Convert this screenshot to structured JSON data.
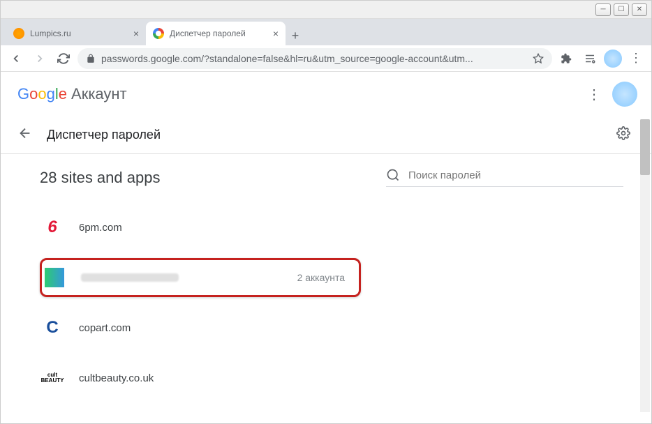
{
  "window": {
    "tabs": [
      {
        "title": "Lumpics.ru",
        "active": false
      },
      {
        "title": "Диспетчер паролей",
        "active": true
      }
    ]
  },
  "toolbar": {
    "url_display": "passwords.google.com/?standalone=false&hl=ru&utm_source=google-account&utm..."
  },
  "google_header": {
    "account_label": "Аккаунт"
  },
  "sub_header": {
    "title": "Диспетчер паролей"
  },
  "content": {
    "sites_count_label": "28 sites and apps",
    "search_placeholder": "Поиск паролей",
    "rows": [
      {
        "name": "6pm.com",
        "meta": ""
      },
      {
        "name": "",
        "name_blurred": true,
        "meta": "2 аккаунта",
        "highlighted": true
      },
      {
        "name": "copart.com",
        "meta": ""
      },
      {
        "name": "cultbeauty.co.uk",
        "meta": ""
      }
    ]
  }
}
